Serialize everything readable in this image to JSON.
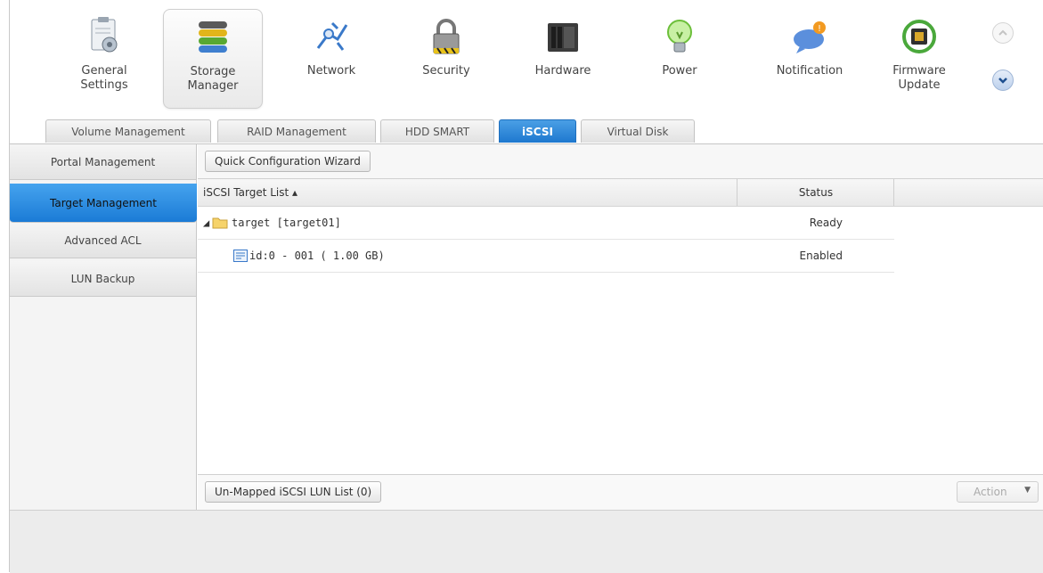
{
  "toolbar": {
    "items": [
      {
        "label": "General\nSettings",
        "icon": "general-settings-icon"
      },
      {
        "label": "Storage\nManager",
        "icon": "storage-manager-icon",
        "active": true
      },
      {
        "label": "Network",
        "icon": "network-icon"
      },
      {
        "label": "Security",
        "icon": "lock-icon"
      },
      {
        "label": "Hardware",
        "icon": "hardware-icon"
      },
      {
        "label": "Power",
        "icon": "power-bulb-icon"
      },
      {
        "label": "Notification",
        "icon": "notification-icon"
      },
      {
        "label": "Firmware\nUpdate",
        "icon": "firmware-chip-icon"
      }
    ],
    "scroll_up_icon": "chevron-up-icon",
    "scroll_down_icon": "chevron-down-icon"
  },
  "tabs": [
    {
      "label": "Volume Management"
    },
    {
      "label": "RAID Management"
    },
    {
      "label": "HDD SMART"
    },
    {
      "label": "iSCSI",
      "active": true
    },
    {
      "label": "Virtual Disk"
    }
  ],
  "sidebar": {
    "items": [
      {
        "label": "Portal Management"
      },
      {
        "label": "Target Management",
        "active": true
      },
      {
        "label": "Advanced ACL"
      },
      {
        "label": "LUN Backup"
      }
    ]
  },
  "main": {
    "wizard_button": "Quick Configuration Wizard",
    "columns": {
      "name": "iSCSI Target List ▴",
      "status": "Status"
    },
    "rows": [
      {
        "name": "target [target01]",
        "status": "Ready",
        "icon": "folder-icon"
      },
      {
        "name": "id:0 - 001 ( 1.00 GB)",
        "status": "Enabled",
        "icon": "lun-icon"
      }
    ],
    "unmapped_button": "Un-Mapped iSCSI LUN List (0)",
    "action_button": "Action"
  },
  "colors": {
    "accent": "#1e78cf",
    "tab_active": "#2b86da"
  }
}
